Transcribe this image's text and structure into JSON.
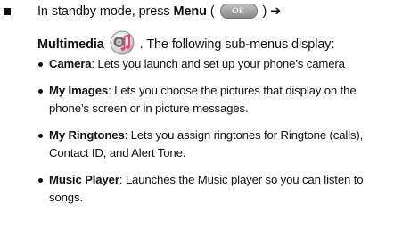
{
  "intro": {
    "line1_prefix": "In standby mode, press",
    "menu_label": "Menu",
    "open_paren": "(",
    "key_label": "OK",
    "close_paren_arrow": ") ➔",
    "multimedia_label": "Multimedia",
    "line2_suffix": ". The following sub-menus display:"
  },
  "items": [
    {
      "term": "Camera",
      "desc": ": Lets you launch and set up your phone’s camera"
    },
    {
      "term": "My Images",
      "desc": ": Lets you choose the pictures that display on the phone’s screen or in picture messages."
    },
    {
      "term": "My Ringtones",
      "desc": ": Lets you assign ringtones for Ringtone (calls), Contact ID, and Alert Tone."
    },
    {
      "term": "Music Player",
      "desc": ": Launches the Music player so you can listen to songs."
    }
  ],
  "icons": {
    "bullet": "square-bullet-icon",
    "multimedia": "multimedia-icon"
  },
  "colors": {
    "text": "#111111",
    "key_bg": "#a8a8a8",
    "icon_accent": "#e0457b"
  }
}
